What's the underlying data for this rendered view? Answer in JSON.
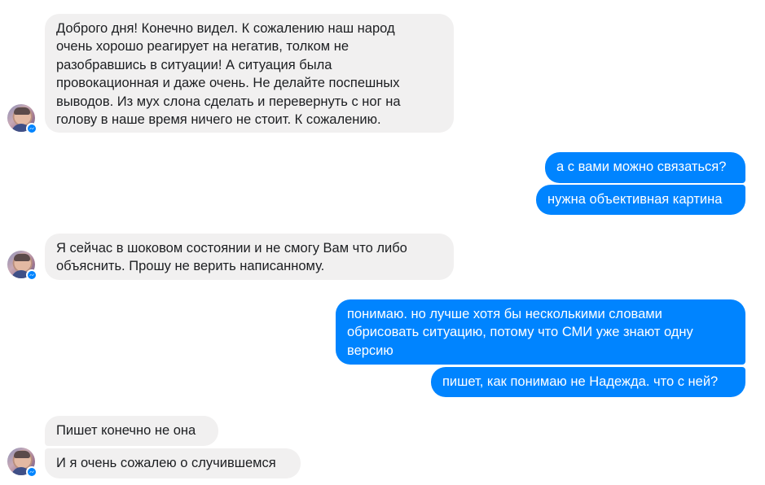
{
  "colors": {
    "incoming_bubble": "#f1f0f0",
    "outgoing_bubble": "#0084ff",
    "outgoing_text": "#ffffff",
    "incoming_text": "#1c1e21",
    "messenger_badge": "#0084ff"
  },
  "icons": {
    "avatar": "contact-avatar",
    "badge": "messenger-badge-icon"
  },
  "messages": [
    {
      "direction": "in",
      "lines": [
        "Доброго дня! Конечно видел. К сожалению наш народ",
        "очень хорошо реагирует на негатив, толком не",
        "разобравшись в ситуации! А ситуация была",
        "провокационная и даже очень. Не делайте поспешных",
        "выводов. Из мух слона сделать и перевернуть с ног на",
        "голову в наше время ничего не стоит. К сожалению."
      ]
    },
    {
      "direction": "out",
      "lines": [
        "а с вами можно связаться?"
      ]
    },
    {
      "direction": "out",
      "lines": [
        "нужна объективная картина"
      ]
    },
    {
      "direction": "in",
      "lines": [
        "Я сейчас в шоковом состоянии и не смогу Вам что либо",
        "объяснить. Прошу не верить написанному."
      ]
    },
    {
      "direction": "out",
      "lines": [
        "понимаю. но лучше хотя бы несколькими словами",
        "обрисовать ситуацию, потому что СМИ уже знают одну",
        "версию"
      ]
    },
    {
      "direction": "out",
      "lines": [
        "пишет, как понимаю не Надежда. что с ней?"
      ]
    },
    {
      "direction": "in",
      "lines": [
        "Пишет конечно не она"
      ]
    },
    {
      "direction": "in",
      "lines": [
        "И я очень сожалею о случившемся"
      ]
    }
  ]
}
